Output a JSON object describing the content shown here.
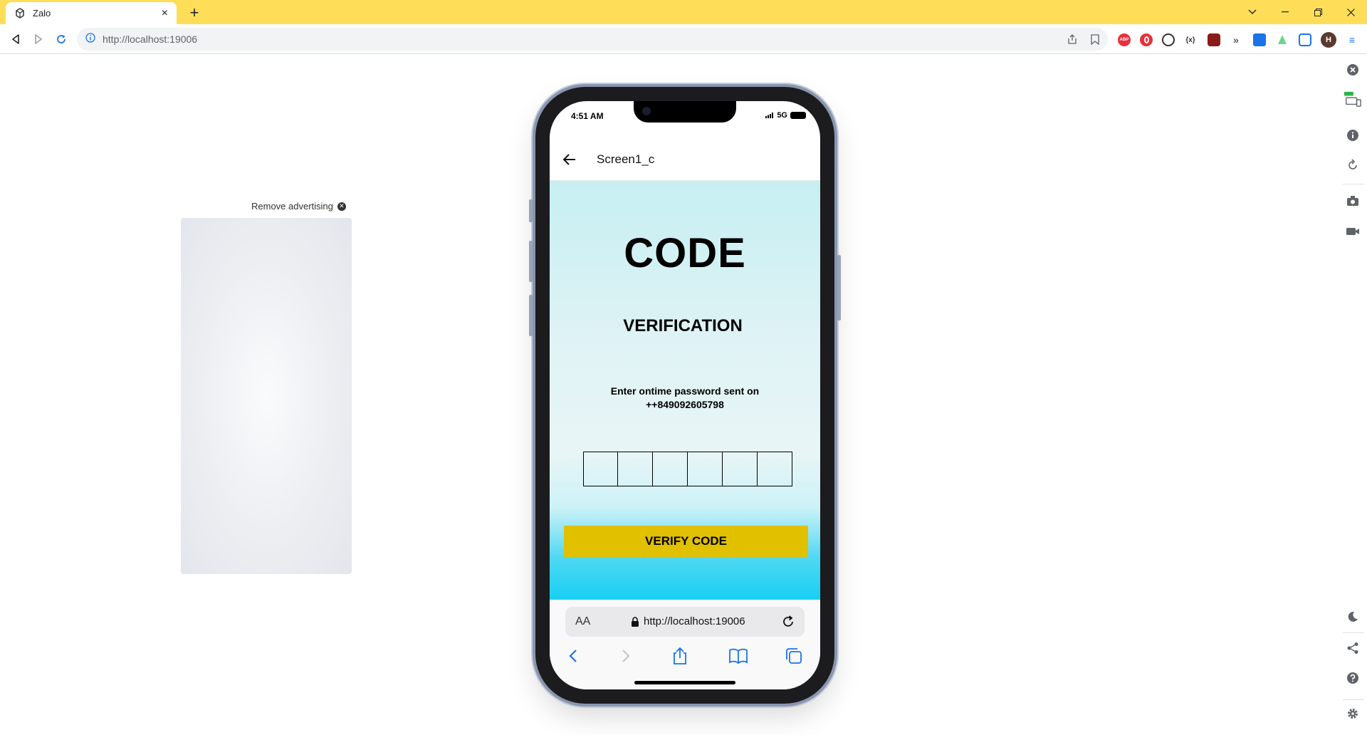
{
  "browser": {
    "tab_title": "Zalo",
    "tab_close": "×",
    "new_tab": "+",
    "url": "http://localhost:19006",
    "profile_initial": "H",
    "ext_abp": "ABP"
  },
  "page": {
    "remove_ad_label": "Remove advertising"
  },
  "phone": {
    "time": "4:51 AM",
    "network": "5G",
    "screen_title": "Screen1_c",
    "heading": "CODE",
    "subheading": "VERIFICATION",
    "instruction_line1": "Enter ontime password sent on",
    "instruction_line2": "++849092605798",
    "otp_boxes": [
      "",
      "",
      "",
      "",
      "",
      ""
    ],
    "verify_label": "VERIFY CODE",
    "safari_aa": "AA",
    "safari_url": "http://localhost:19006"
  },
  "colors": {
    "tabbar": "#fede58",
    "verify_button": "#e1c000",
    "gradient_bottom": "#18d0f3"
  }
}
